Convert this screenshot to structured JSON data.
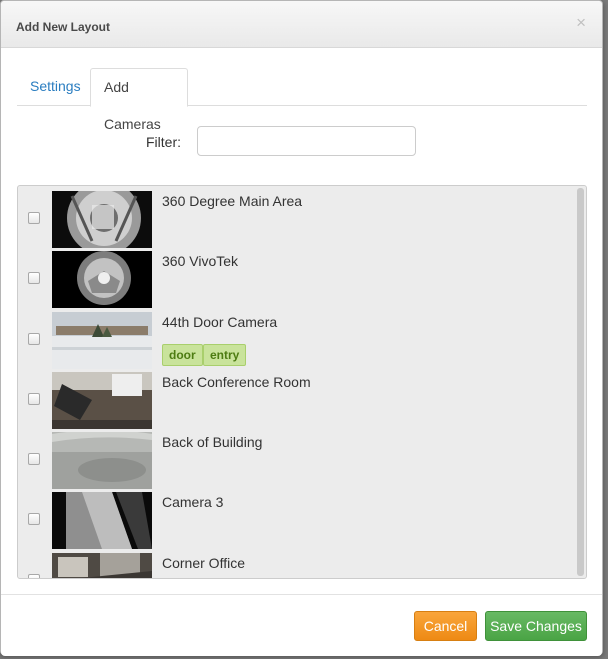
{
  "dialog": {
    "title": "Add New Layout",
    "close_glyph": "×"
  },
  "tabs": [
    {
      "label": "Settings",
      "active": false
    },
    {
      "label": "Add Cameras",
      "active": true
    }
  ],
  "filter": {
    "label": "Filter:",
    "value": "",
    "placeholder": ""
  },
  "cameras": [
    {
      "name": "360 Degree Main Area",
      "checked": false,
      "tags": []
    },
    {
      "name": "360 VivoTek",
      "checked": false,
      "tags": []
    },
    {
      "name": "44th Door Camera",
      "checked": false,
      "tags": [
        "door",
        "entry"
      ]
    },
    {
      "name": "Back Conference Room",
      "checked": false,
      "tags": []
    },
    {
      "name": "Back of Building",
      "checked": false,
      "tags": []
    },
    {
      "name": "Camera 3",
      "checked": false,
      "tags": []
    },
    {
      "name": "Corner Office",
      "checked": false,
      "tags": []
    }
  ],
  "footer": {
    "cancel_label": "Cancel",
    "save_label": "Save Changes"
  },
  "colors": {
    "tab_link": "#2a7dc0",
    "cancel_button": "#f0901a",
    "save_button": "#55ac50",
    "tag_background": "#c9e39b",
    "tag_text": "#4d7c12"
  }
}
